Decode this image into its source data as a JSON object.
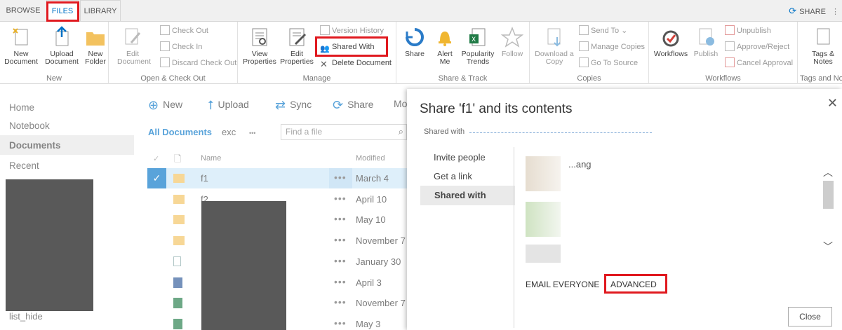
{
  "tabs": {
    "browse": "BROWSE",
    "files": "FILES",
    "library": "LIBRARY",
    "share": "SHARE"
  },
  "ribbon": {
    "new_group": {
      "label": "New",
      "new_document": "New\nDocument",
      "upload_document": "Upload\nDocument",
      "new_folder": "New\nFolder"
    },
    "open_group": {
      "label": "Open & Check Out",
      "edit_document": "Edit\nDocument",
      "check_out": "Check Out",
      "check_in": "Check In",
      "discard_check_out": "Discard Check Out"
    },
    "manage_group": {
      "label": "Manage",
      "view_properties": "View\nProperties",
      "edit_properties": "Edit\nProperties",
      "version_history": "Version History",
      "shared_with": "Shared With",
      "delete_document": "Delete Document"
    },
    "share_group": {
      "label": "Share & Track",
      "share": "Share",
      "alert_me": "Alert\nMe",
      "popularity_trends": "Popularity\nTrends",
      "follow": "Follow"
    },
    "copies_group": {
      "label": "Copies",
      "download_copy": "Download a\nCopy",
      "send_to": "Send To",
      "manage_copies": "Manage Copies",
      "go_to_source": "Go To Source"
    },
    "workflows_group": {
      "label": "Workflows",
      "workflows": "Workflows",
      "publish": "Publish",
      "unpublish": "Unpublish",
      "approve_reject": "Approve/Reject",
      "cancel_approval": "Cancel Approval"
    },
    "tags_group": {
      "label": "Tags and No",
      "tags_notes": "Tags &\nNotes"
    }
  },
  "leftnav": {
    "items": [
      "Home",
      "Notebook",
      "Documents",
      "Recent"
    ],
    "bottom": "list_hide"
  },
  "commands": {
    "new": "New",
    "upload": "Upload",
    "sync": "Sync",
    "share": "Share",
    "more": "Mo"
  },
  "views": {
    "all_documents": "All Documents",
    "exc": "exc",
    "more": "•••",
    "find_placeholder": "Find a file"
  },
  "table": {
    "col_name": "Name",
    "col_modified": "Modified",
    "rows": [
      {
        "name": "f1",
        "modified": "March 4",
        "icon": "folder-icon",
        "selected": true
      },
      {
        "name": "f2",
        "modified": "April 10",
        "icon": "folder-icon"
      },
      {
        "name": "",
        "modified": "May 10",
        "icon": "folder-icon"
      },
      {
        "name": "",
        "modified": "November 7",
        "icon": "folder-icon"
      },
      {
        "name": "",
        "modified": "January 30",
        "icon": "generic-file-icon"
      },
      {
        "name": "",
        "modified": "April 3",
        "icon": "word-file-icon"
      },
      {
        "name": "",
        "modified": "November 7",
        "icon": "excel-file-icon"
      },
      {
        "name": "",
        "modified": "May 3",
        "icon": "excel-file-icon"
      }
    ]
  },
  "dialog": {
    "title": "Share 'f1' and its contents",
    "shared_with_prefix": "Shared with",
    "nav": {
      "invite": "Invite people",
      "get_link": "Get a link",
      "shared_with": "Shared with"
    },
    "people": [
      {
        "name": "...ang"
      },
      {
        "name": ""
      },
      {
        "name": ""
      }
    ],
    "email_everyone": "EMAIL EVERYONE",
    "advanced": "ADVANCED",
    "close": "Close"
  },
  "colors": {
    "accent": "#0072c6",
    "highlight_red": "#e0191f",
    "selected_row": "#cde6f7"
  }
}
